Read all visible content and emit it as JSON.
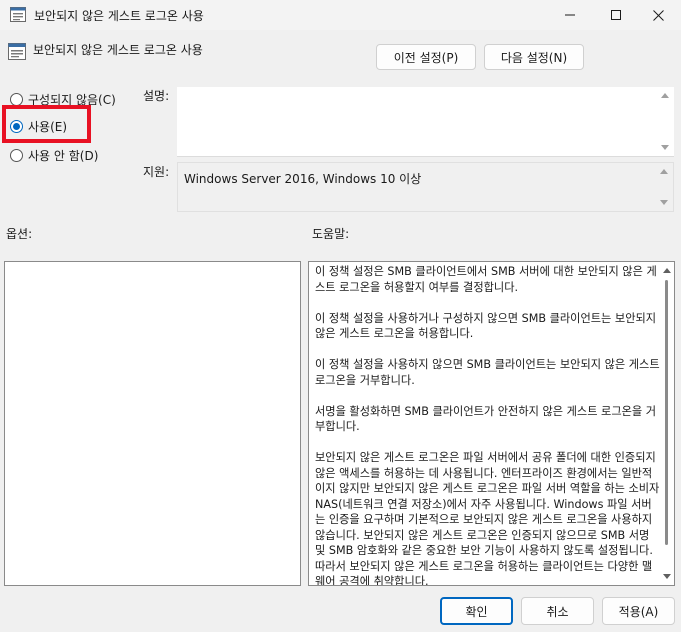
{
  "window": {
    "title": "보안되지 않은 게스트 로그온 사용"
  },
  "header": {
    "policy_title": "보안되지 않은 게스트 로그온 사용",
    "prev_button": "이전 설정(P)",
    "next_button": "다음 설정(N)"
  },
  "state": {
    "not_configured": "구성되지 않음(C)",
    "enabled": "사용(E)",
    "disabled": "사용 안 함(D)",
    "selected": "enabled"
  },
  "labels": {
    "description": "설명:",
    "supported_on": "지원:",
    "options": "옵션:",
    "help": "도움말:"
  },
  "supported_on": "Windows Server 2016, Windows 10 이상",
  "help_paragraphs": [
    "이 정책 설정은 SMB 클라이언트에서 SMB 서버에 대한 보안되지 않은 게스트 로그온을 허용할지 여부를 결정합니다.",
    "이 정책 설정을 사용하거나 구성하지 않으면 SMB 클라이언트는 보안되지 않은 게스트 로그온을 허용합니다.",
    "이 정책 설정을 사용하지 않으면 SMB 클라이언트는 보안되지 않은 게스트 로그온을 거부합니다.",
    "서명을 활성화하면 SMB 클라이언트가 안전하지 않은 게스트 로그온을 거부합니다.",
    "보안되지 않은 게스트 로그온은 파일 서버에서 공유 폴더에 대한 인증되지 않은 액세스를 허용하는 데 사용됩니다. 엔터프라이즈 환경에서는 일반적이지 않지만 보안되지 않은 게스트 로그온은 파일 서버 역할을 하는 소비자 NAS(네트워크 연결 저장소)에서 자주 사용됩니다. Windows 파일 서버는 인증을 요구하며 기본적으로 보안되지 않은 게스트 로그온을 사용하지 않습니다. 보안되지 않은 게스트 로그온은 인증되지 않으므로 SMB 서명 및 SMB 암호화와 같은 중요한 보안 기능이 사용하지 않도록 설정됩니다. 따라서 보안되지 않은 게스트 로그온을 허용하는 클라이언트는 다양한 맬웨어 공격에 취약합니다."
  ],
  "footer": {
    "ok": "확인",
    "cancel": "취소",
    "apply": "적용(A)"
  },
  "colors": {
    "accent": "#0067c0",
    "highlight": "#e81123"
  }
}
